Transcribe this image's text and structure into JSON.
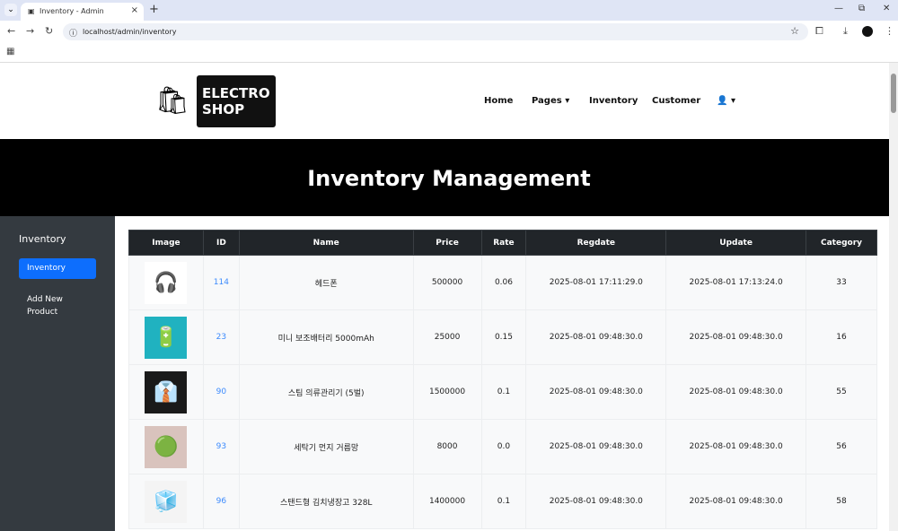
{
  "browser": {
    "tab_title": "Inventory - Admin",
    "url": "localhost/admin/inventory"
  },
  "navbar": {
    "logo_line1": "ELECTRO",
    "logo_line2": "SHOP",
    "menu": [
      "Home",
      "Pages",
      "Inventory",
      "Customer"
    ]
  },
  "hero": {
    "title": "Inventory Management"
  },
  "sidebar": {
    "heading": "Inventory",
    "items": [
      "Inventory",
      "Add New Product"
    ]
  },
  "table": {
    "headers": [
      "Image",
      "ID",
      "Name",
      "Price",
      "Rate",
      "Regdate",
      "Update",
      "Category"
    ],
    "rows": [
      {
        "id": "114",
        "name": "헤드폰",
        "price": "500000",
        "rate": "0.06",
        "regdate": "2025-08-01 17:11:29.0",
        "update": "2025-08-01 17:13:24.0",
        "category": "33",
        "icon": "headphones-icon"
      },
      {
        "id": "23",
        "name": "미니 보조배터리 5000mAh",
        "price": "25000",
        "rate": "0.15",
        "regdate": "2025-08-01 09:48:30.0",
        "update": "2025-08-01 09:48:30.0",
        "category": "16",
        "icon": "battery-icon"
      },
      {
        "id": "90",
        "name": "스팀 의류관리기 (5벌)",
        "price": "1500000",
        "rate": "0.1",
        "regdate": "2025-08-01 09:48:30.0",
        "update": "2025-08-01 09:48:30.0",
        "category": "55",
        "icon": "clothes-care-icon"
      },
      {
        "id": "93",
        "name": "세탁기 먼지 거름망",
        "price": "8000",
        "rate": "0.0",
        "regdate": "2025-08-01 09:48:30.0",
        "update": "2025-08-01 09:48:30.0",
        "category": "56",
        "icon": "filter-icon"
      },
      {
        "id": "96",
        "name": "스탠드형 김치냉장고 328L",
        "price": "1400000",
        "rate": "0.1",
        "regdate": "2025-08-01 09:48:30.0",
        "update": "2025-08-01 09:48:30.0",
        "category": "58",
        "icon": "fridge-icon"
      }
    ]
  }
}
